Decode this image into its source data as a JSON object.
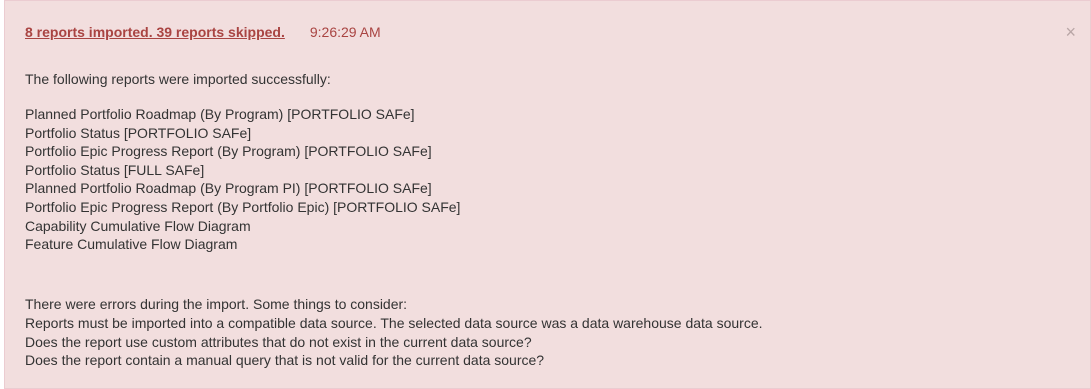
{
  "alert": {
    "summary": "8 reports imported. 39 reports skipped.",
    "time": "9:26:29 AM",
    "close_glyph": "×",
    "success_heading": "The following reports were imported successfully:",
    "imported_reports": [
      "Planned Portfolio Roadmap (By Program) [PORTFOLIO SAFe]",
      "Portfolio Status [PORTFOLIO SAFe]",
      "Portfolio Epic Progress Report (By Program) [PORTFOLIO SAFe]",
      "Portfolio Status [FULL SAFe]",
      "Planned Portfolio Roadmap (By Program PI) [PORTFOLIO SAFe]",
      "Portfolio Epic Progress Report (By Portfolio Epic) [PORTFOLIO SAFe]",
      "Capability Cumulative Flow Diagram",
      "Feature Cumulative Flow Diagram"
    ],
    "error_heading": "There were errors during the import. Some things to consider:",
    "error_notes": [
      "Reports must be imported into a compatible data source. The selected data source was a data warehouse data source.",
      "Does the report use custom attributes that do not exist in the current data source?",
      "Does the report contain a manual query that is not valid for the current data source?"
    ]
  },
  "colors": {
    "alert_background": "#f2dede",
    "alert_text_accent": "#a94442",
    "body_text": "#333333"
  },
  "icons": {
    "close": "close-icon"
  }
}
